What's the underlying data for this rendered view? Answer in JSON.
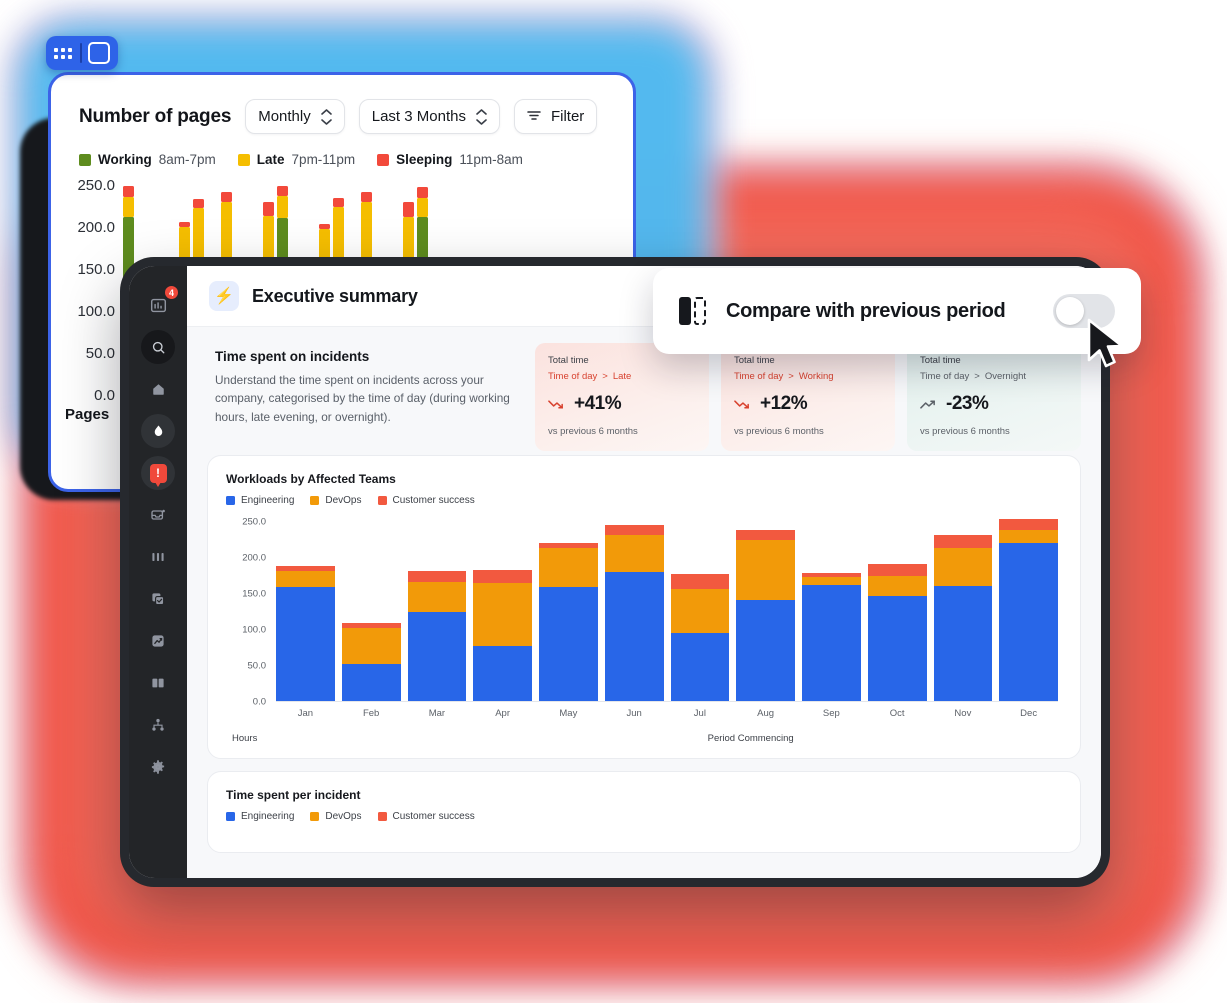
{
  "back_panel": {
    "title": "Number of pages",
    "controls": [
      {
        "label": "Monthly",
        "icon": "chevron-updown-icon"
      },
      {
        "label": "Last 3 Months",
        "icon": "chevron-updown-icon"
      },
      {
        "label": "Filter",
        "icon": "filter-icon"
      }
    ],
    "legend": [
      {
        "name": "Working",
        "range": "8am-7pm",
        "color": "#5E8C1E"
      },
      {
        "name": "Late",
        "range": "7pm-11pm",
        "color": "#F5BE00"
      },
      {
        "name": "Sleeping",
        "range": "11pm-8am",
        "color": "#F2493B"
      }
    ],
    "y_axis_label": "Pages",
    "y_ticks": [
      "250.0",
      "200.0",
      "150.0",
      "100.0",
      "50.0",
      "0.0"
    ],
    "toolbar": {
      "grid_icon": "grid-icon",
      "panel_icon": "panel-icon"
    }
  },
  "sidebar": {
    "items": [
      {
        "name": "reports-icon",
        "badge": "4"
      },
      {
        "name": "search-icon",
        "badge": ""
      },
      {
        "name": "home-icon",
        "badge": ""
      },
      {
        "name": "fire-icon",
        "badge": ""
      },
      {
        "name": "alert-icon",
        "badge": ""
      },
      {
        "name": "inbox-icon",
        "badge": ""
      },
      {
        "name": "columns-icon",
        "badge": ""
      },
      {
        "name": "tasks-icon",
        "badge": ""
      },
      {
        "name": "analytics-icon",
        "badge": ""
      },
      {
        "name": "book-icon",
        "badge": ""
      },
      {
        "name": "hierarchy-icon",
        "badge": ""
      },
      {
        "name": "settings-icon",
        "badge": ""
      }
    ]
  },
  "header": {
    "title": "Executive summary",
    "icon": "bolt-icon"
  },
  "intro": {
    "heading": "Time spent on incidents",
    "body": "Understand the time spent on incidents across your company, categorised by the time of day (during working hours, late evening, or overnight)."
  },
  "metric_cards": [
    {
      "label": "Total time",
      "breadcrumb_root": "Time of day",
      "breadcrumb_sep": ">",
      "breadcrumb_leaf": "Late",
      "value": "+41%",
      "footnote": "vs previous 6 months",
      "tone": "red",
      "trend": "trend-down-icon"
    },
    {
      "label": "Total time",
      "breadcrumb_root": "Time of day",
      "breadcrumb_sep": ">",
      "breadcrumb_leaf": "Working",
      "value": "+12%",
      "footnote": "vs previous 6 months",
      "tone": "red",
      "trend": "trend-down-icon"
    },
    {
      "label": "Total time",
      "breadcrumb_root": "Time of day",
      "breadcrumb_sep": ">",
      "breadcrumb_leaf": "Overnight",
      "value": "-23%",
      "footnote": "vs previous 6 months",
      "tone": "teal",
      "trend": "trend-up-icon"
    }
  ],
  "lower_panel": {
    "title": "Time spent per incident",
    "legend": [
      "Engineering",
      "DevOps",
      "Customer success"
    ]
  },
  "colors": {
    "engineering": "#2866E8",
    "devops": "#F29A09",
    "customer_success": "#F2593F",
    "working": "#5E8C1E",
    "late": "#F5BE00",
    "sleeping": "#F2493B",
    "accent_blue": "#2E63E8",
    "glow_red": "#F0493B",
    "glow_blue": "#4BB9F0"
  },
  "float_card": {
    "title": "Compare with previous period",
    "icon": "compare-periods-icon",
    "toggle_state": "off"
  },
  "chart_data": {
    "type": "bar",
    "title": "Workloads by Affected Teams",
    "stacked": true,
    "xlabel": "Period Commencing",
    "ylabel": "Hours",
    "ylim": [
      0,
      250
    ],
    "yticks": [
      250.0,
      200.0,
      150.0,
      100.0,
      50.0,
      0.0
    ],
    "ytick_labels": [
      "250.0",
      "200.0",
      "150.0",
      "100.0",
      "50.0",
      "0.0"
    ],
    "grid": false,
    "legend_position": "top-left",
    "categories": [
      "Jan",
      "Feb",
      "Mar",
      "Apr",
      "May",
      "Jun",
      "Jul",
      "Aug",
      "Sep",
      "Oct",
      "Nov",
      "Dec"
    ],
    "series": [
      {
        "name": "Engineering",
        "color": "#2866E8",
        "values": [
          158,
          52,
          124,
          76,
          158,
          179,
          95,
          140,
          161,
          146,
          160,
          219
        ]
      },
      {
        "name": "DevOps",
        "color": "#F29A09",
        "values": [
          22,
          50,
          41,
          88,
          55,
          52,
          60,
          83,
          11,
          28,
          52,
          19
        ]
      },
      {
        "name": "Customer success",
        "color": "#F2593F",
        "values": [
          7,
          6,
          15,
          18,
          6,
          13,
          21,
          14,
          6,
          16,
          18,
          15
        ]
      }
    ]
  },
  "back_chart_data": {
    "type": "bar",
    "title": "Number of pages",
    "stacked": true,
    "ylabel": "Pages",
    "ylim": [
      0,
      270
    ],
    "yticks": [
      250.0,
      200.0,
      150.0,
      100.0,
      50.0,
      0.0
    ],
    "legend": [
      "Working 8am-7pm",
      "Late 7pm-11pm",
      "Sleeping 11pm-8am"
    ],
    "groups": [
      {
        "working": 218,
        "late": 245,
        "sleeping": 260
      },
      {
        "working": 0,
        "late": 3,
        "sleeping": 8
      },
      {
        "working": 0,
        "late": 0,
        "sleeping": 0
      },
      {
        "working": 0,
        "late": 0,
        "sleeping": 0
      },
      {
        "working": 0,
        "late": 205,
        "sleeping": 212
      },
      {
        "working": 0,
        "late": 230,
        "sleeping": 243
      },
      {
        "working": 0,
        "late": 0,
        "sleeping": 3
      },
      {
        "working": 0,
        "late": 238,
        "sleeping": 252
      },
      {
        "working": 0,
        "late": 2,
        "sleeping": 6
      },
      {
        "working": 0,
        "late": 0,
        "sleeping": 0
      },
      {
        "working": 0,
        "late": 220,
        "sleeping": 238
      },
      {
        "working": 217,
        "late": 246,
        "sleeping": 260
      },
      {
        "working": 0,
        "late": 2,
        "sleeping": 7
      },
      {
        "working": 0,
        "late": 0,
        "sleeping": 0
      },
      {
        "working": 0,
        "late": 203,
        "sleeping": 210
      },
      {
        "working": 0,
        "late": 232,
        "sleeping": 244
      },
      {
        "working": 0,
        "late": 0,
        "sleeping": 0
      },
      {
        "working": 0,
        "late": 238,
        "sleeping": 251
      },
      {
        "working": 0,
        "late": 0,
        "sleeping": 3
      },
      {
        "working": 0,
        "late": 0,
        "sleeping": 0
      },
      {
        "working": 0,
        "late": 218,
        "sleeping": 238
      },
      {
        "working": 218,
        "late": 244,
        "sleeping": 258
      }
    ]
  }
}
